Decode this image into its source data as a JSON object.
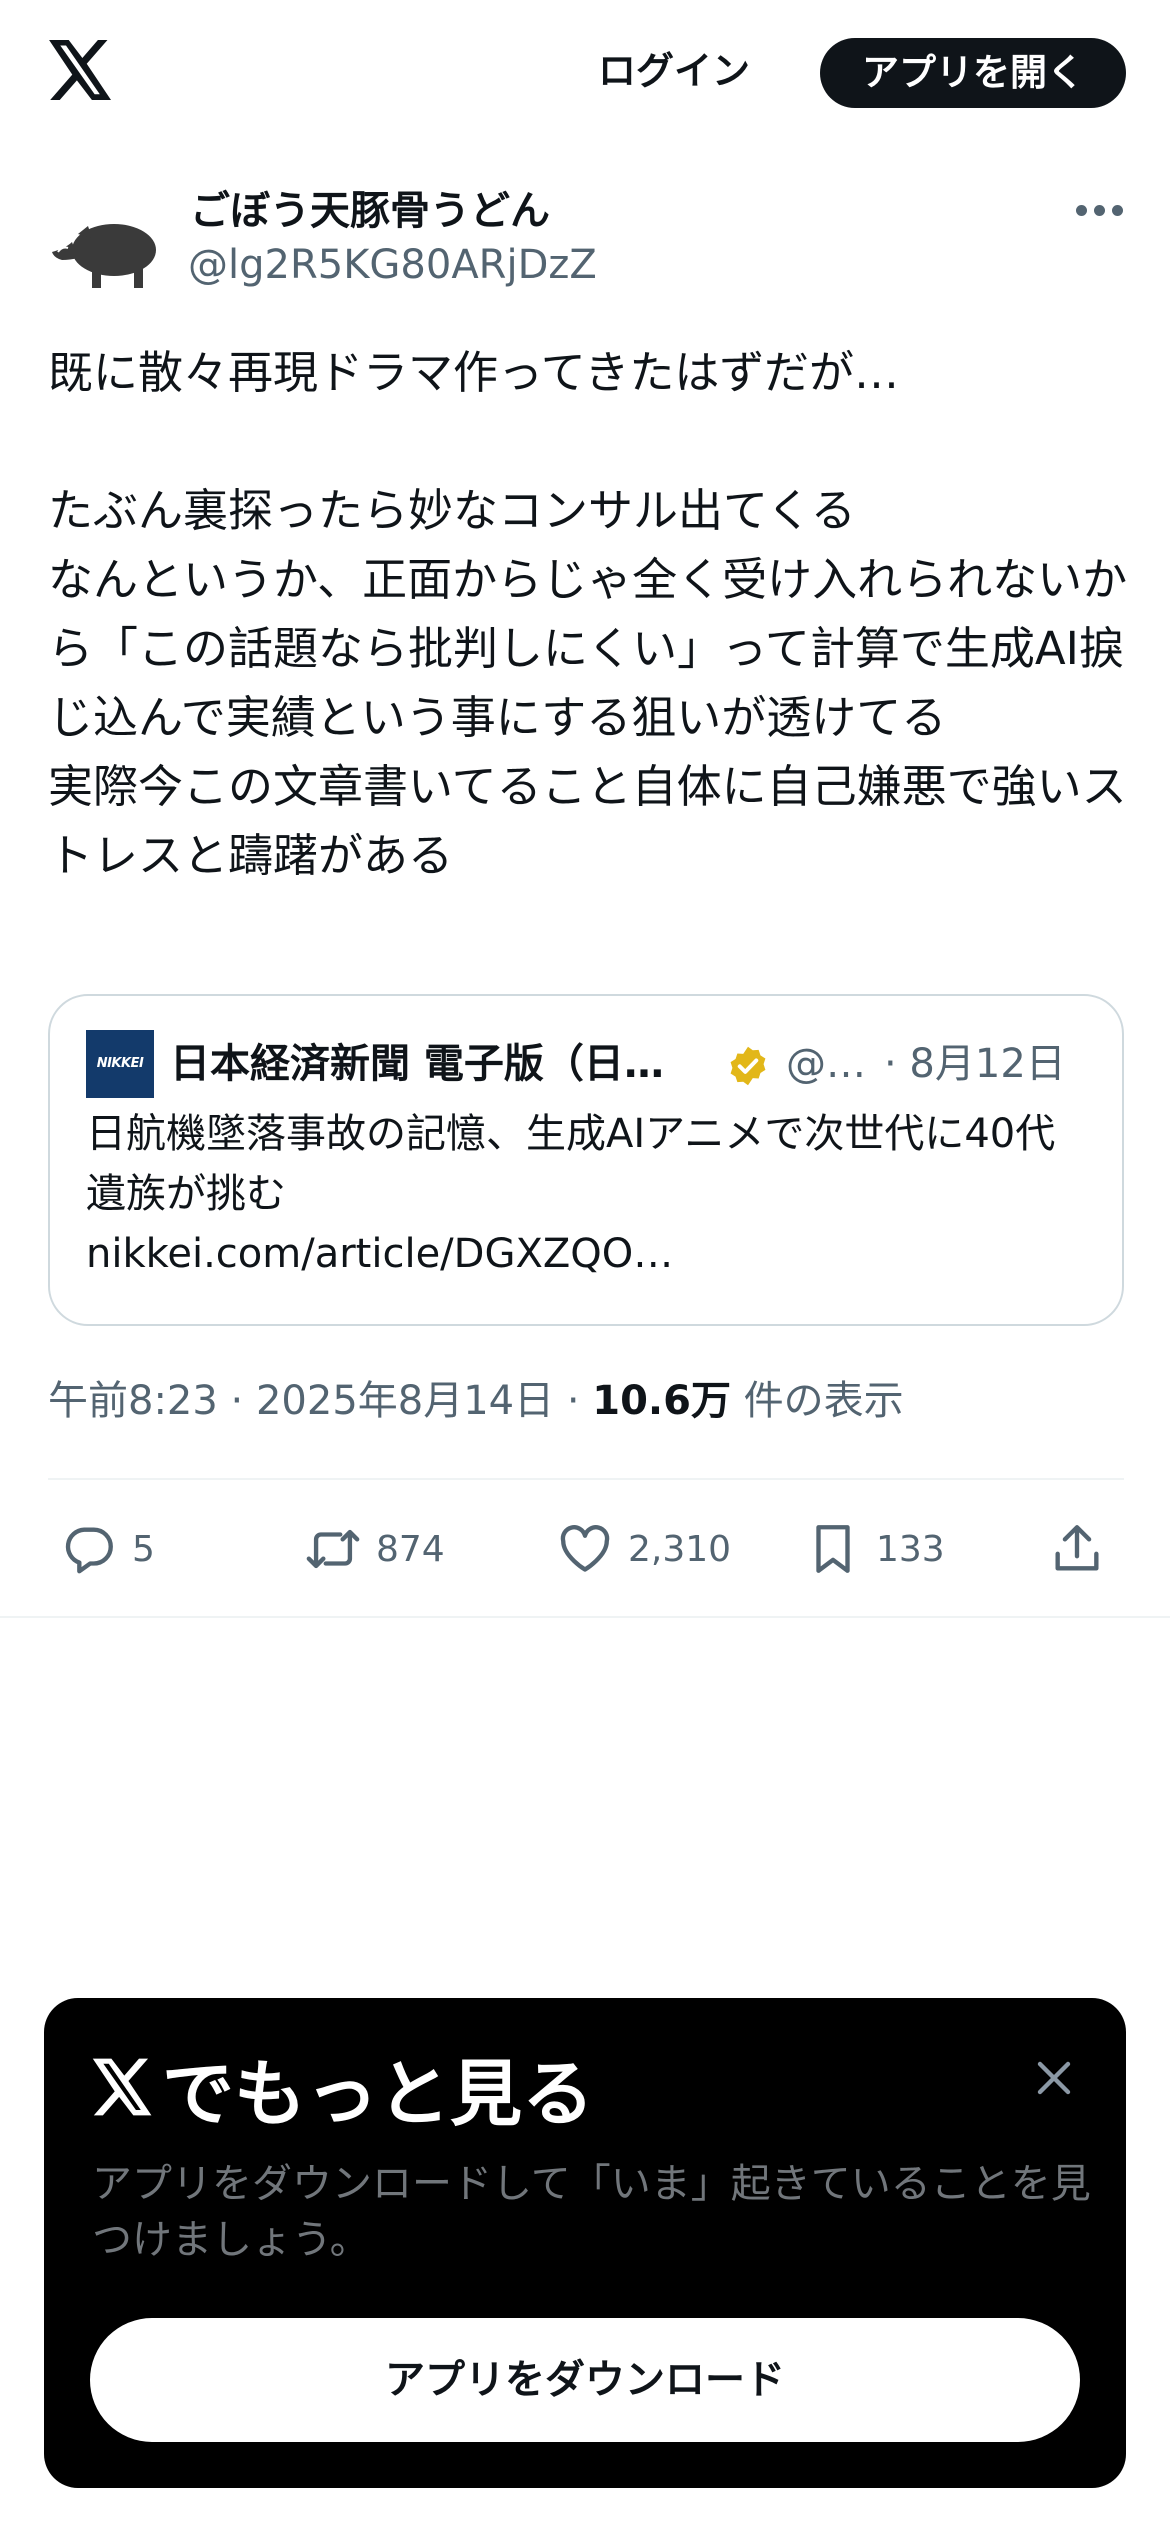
{
  "header": {
    "logo_icon": "x-logo-icon",
    "login_label": "ログイン",
    "open_app_label": "アプリを開く"
  },
  "tweet": {
    "author": {
      "display_name": "ごぼう天豚骨うどん",
      "handle": "@lg2R5KG80ARjDzZ",
      "avatar_icon": "boar-avatar"
    },
    "text": "既に散々再現ドラマ作ってきたはずだが…\n\nたぶん裏探ったら妙なコンサル出てくる\nなんというか、正面からじゃ全く受け入れられないから「この話題なら批判しにくい」って計算で生成AI捩じ込んで実績という事にする狙いが透けてる\n実際今この文章書いてること自体に自己嫌悪で強いストレスと躊躇がある",
    "quote": {
      "logo_text": "NIKKEI",
      "name": "日本経済新聞 電子版（日本経済新聞 電子版）",
      "handle": "@nikkei",
      "date": "· 8月12日",
      "text": "日航機墜落事故の記憶、生成AIアニメで次世代に40代遺族が挑む",
      "link": "nikkei.com/article/DGXZQO…"
    },
    "meta": {
      "time_date": "午前8:23 · 2025年8月14日 · ",
      "views_count": "10.6万",
      "views_label": " 件の表示"
    },
    "actions": {
      "replies": "5",
      "retweets": "874",
      "likes": "2,310",
      "bookmarks": "133"
    }
  },
  "sheet": {
    "title": "でもっと見る",
    "description": "アプリをダウンロードして「いま」起きていることを見つけましょう。",
    "button_label": "アプリをダウンロード"
  },
  "colors": {
    "text_primary": "#0f1419",
    "text_secondary": "#536471",
    "border": "#cfd9de",
    "verified_gold": "#e2b719",
    "sheet_bg": "#000000"
  }
}
